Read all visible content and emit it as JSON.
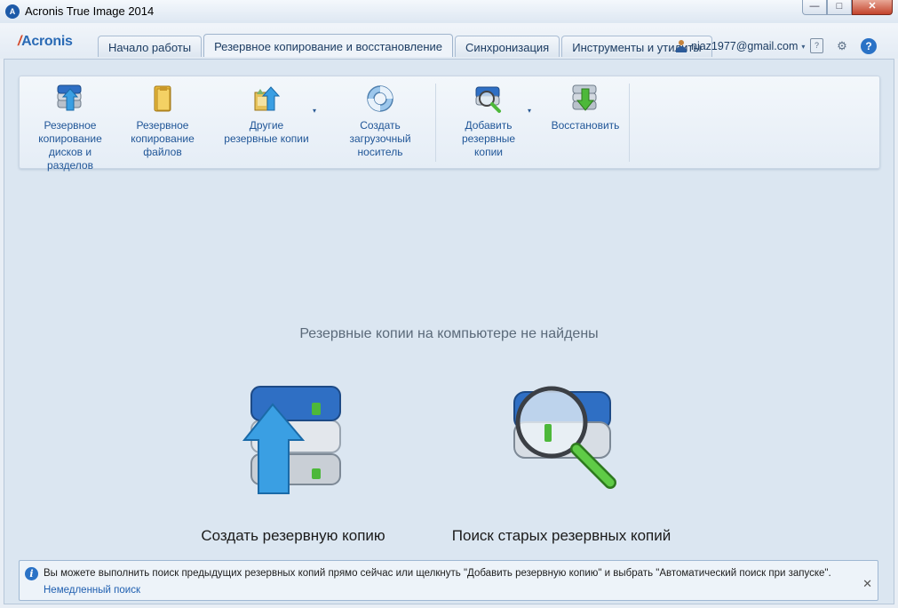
{
  "window": {
    "icon_letter": "A",
    "title": "Acronis True Image 2014",
    "minimize": "—",
    "maximize": "□",
    "close": "✕"
  },
  "header": {
    "logo": "Acronis",
    "tabs": [
      {
        "label": "Начало работы",
        "active": false
      },
      {
        "label": "Резервное копирование и восстановление",
        "active": true
      },
      {
        "label": "Синхронизация",
        "active": false
      },
      {
        "label": "Инструменты и утилиты",
        "active": false
      }
    ],
    "account_email": "niaz1977@gmail.com",
    "help_glyph": "?",
    "settings_glyph": "⚙",
    "clipboard_glyph": "?"
  },
  "ribbon": {
    "buttons": [
      {
        "label_lines": [
          "Резервное",
          "копирование",
          "дисков и",
          "разделов"
        ],
        "icon": "disk-backup-icon"
      },
      {
        "label_lines": [
          "Резервное",
          "копирование",
          "файлов"
        ],
        "icon": "folder-backup-icon"
      },
      {
        "label_lines": [
          "Другие",
          "резервные копии"
        ],
        "icon": "other-backups-icon",
        "has_dropdown": true
      },
      {
        "label_lines": [
          "Создать",
          "загрузочный",
          "носитель"
        ],
        "icon": "lifebuoy-icon"
      },
      {
        "label_lines": [
          "Добавить",
          "резервные",
          "копии"
        ],
        "icon": "add-backup-icon",
        "has_dropdown": true
      },
      {
        "label_lines": [
          "Восстановить"
        ],
        "icon": "restore-icon"
      }
    ],
    "dropdown_glyph": "▾"
  },
  "main": {
    "empty_message": "Резервные копии на компьютере не найдены",
    "create_backup_label": "Создать резервную копию",
    "search_backups_label": "Поиск старых резервных копий"
  },
  "infobar": {
    "icon_glyph": "i",
    "text": "Вы можете выполнить поиск предыдущих резервных копий прямо сейчас или щелкнуть \"Добавить резервную копию\" и выбрать \"Автоматический поиск при запуске\".",
    "link": "Немедленный поиск",
    "close_glyph": "✕"
  },
  "colors": {
    "accent": "#2a72c6",
    "brand_red": "#d4492a",
    "link": "#1f5fb0",
    "disk_blue": "#2f6fc4",
    "arrow_blue": "#3a9fe3",
    "magnifier_green": "#4db83a"
  }
}
